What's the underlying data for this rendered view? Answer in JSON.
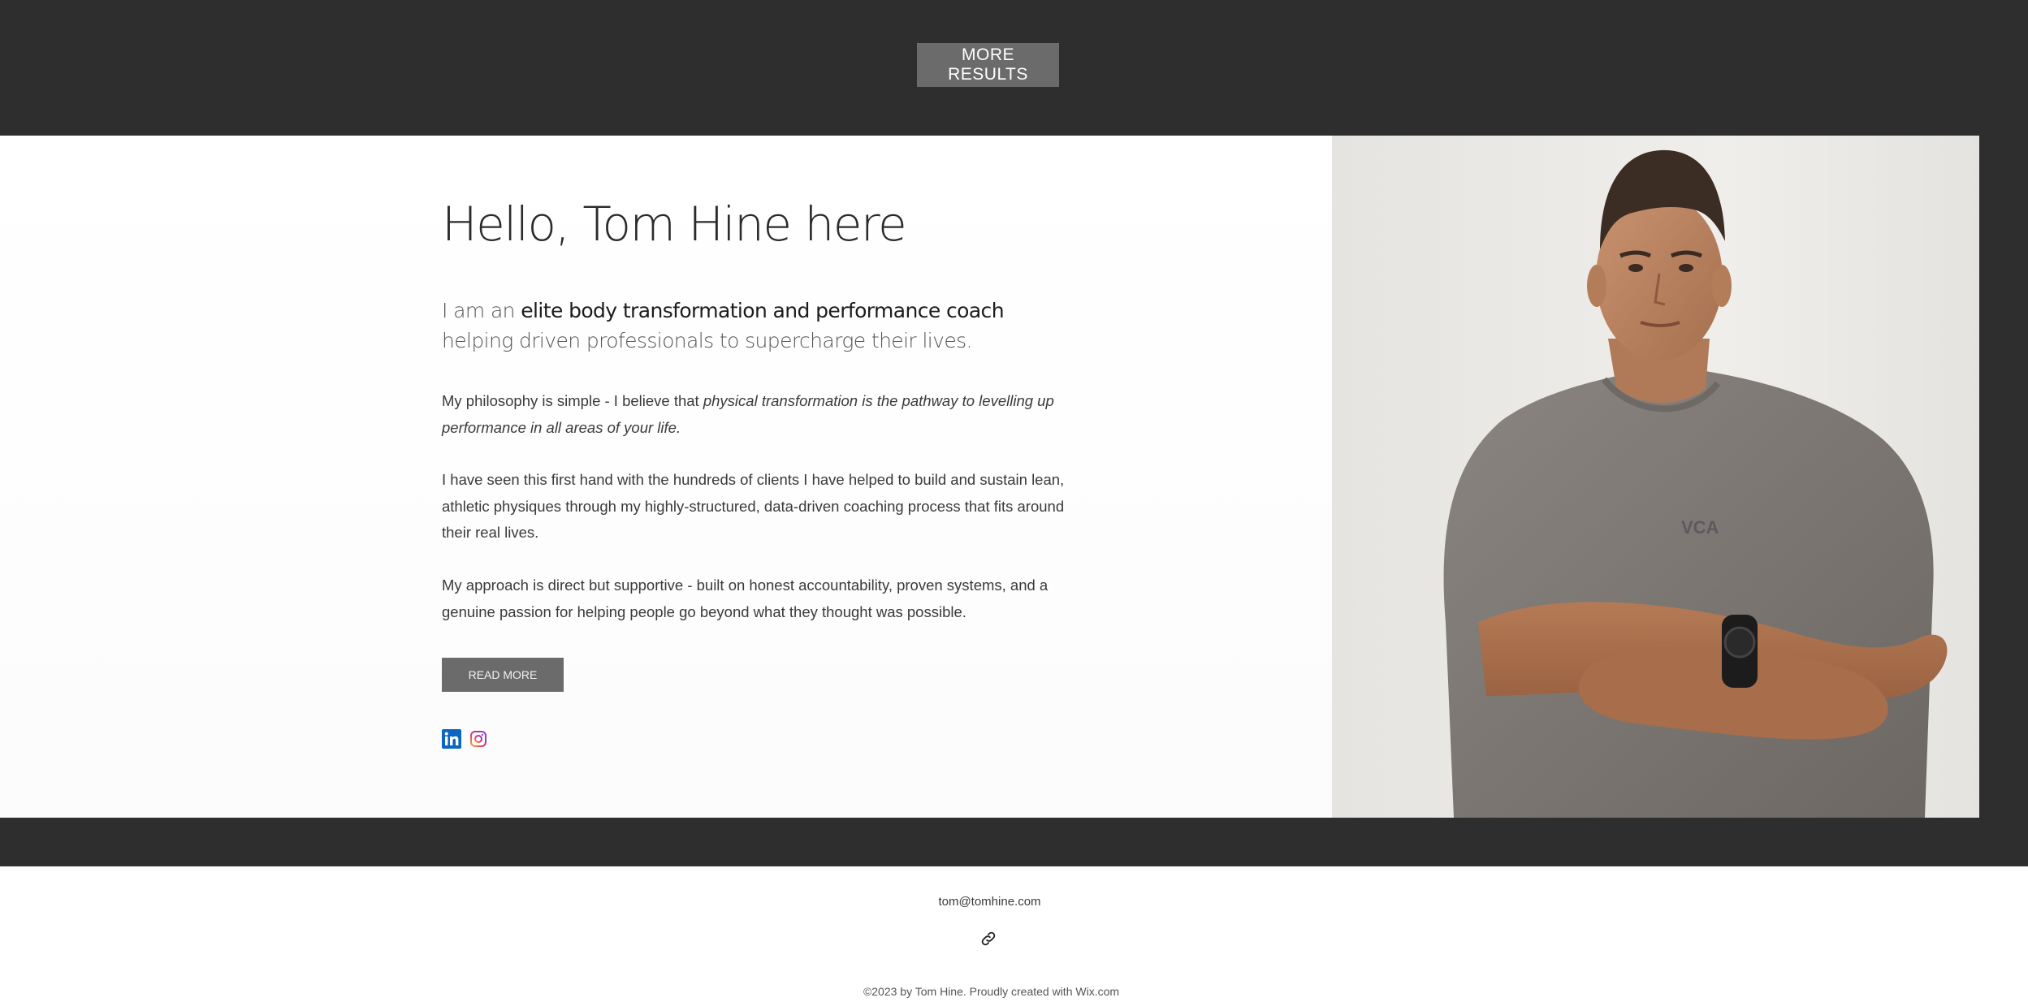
{
  "top": {
    "more_results_label": "MORE RESULTS"
  },
  "hero": {
    "title": "Hello, Tom Hine here",
    "lead_prefix": "I am an ",
    "lead_highlight": "elite body transformation and performance coach",
    "lead_suffix": " helping driven professionals to supercharge their lives.",
    "p1_plain": "My philosophy is simple - I believe that ",
    "p1_italic": "physical transformation is the pathway to levelling up performance in all areas of your life.",
    "p2": "I have seen this first hand with the hundreds of clients I have helped to build and sustain lean, athletic physiques through my highly-structured, data-driven coaching process that fits around their real lives.",
    "p3": "My approach is direct but supportive - built on honest accountability, proven systems, and a genuine passion for helping people go beyond what they thought was possible.",
    "read_more_label": "READ MORE",
    "social": [
      {
        "name": "linkedin-icon",
        "color": "#0a66c2"
      },
      {
        "name": "instagram-icon",
        "color": "#e1306c"
      }
    ],
    "photo_alt": "Tom Hine portrait"
  },
  "footer": {
    "email": "tom@tomhine.com",
    "link_icon": "link-icon",
    "copyright": "©2023 by Tom Hine. Proudly created with Wix.com"
  },
  "colors": {
    "dark_band": "#2e2e2e",
    "button_gray": "#6b6b6b"
  }
}
